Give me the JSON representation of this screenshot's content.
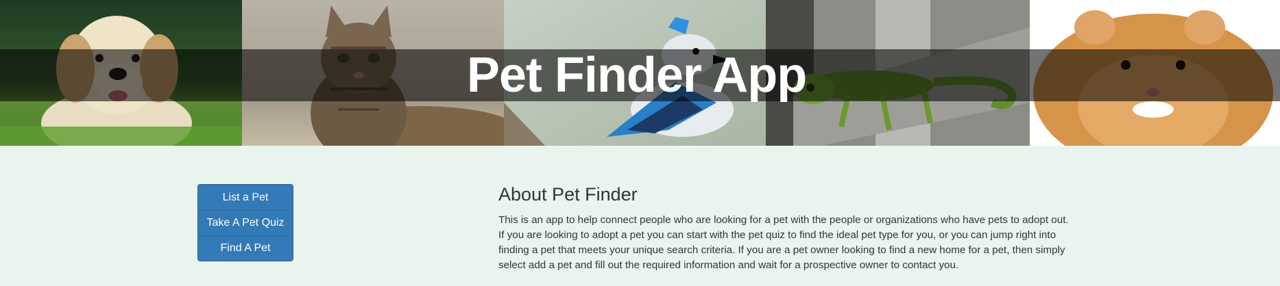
{
  "header": {
    "title": "Pet Finder App"
  },
  "banner": {
    "photos": [
      "dog-photo",
      "cat-photo",
      "blue-jay-photo",
      "chameleon-photo",
      "hamster-photo"
    ]
  },
  "nav": {
    "buttons": [
      {
        "label": "List a Pet"
      },
      {
        "label": "Take A Pet Quiz"
      },
      {
        "label": "Find A Pet"
      }
    ]
  },
  "about": {
    "heading": "About Pet Finder",
    "body": "This is an app to help connect people who are looking for a pet with the people or organizations who have pets to adopt out. If you are looking to adopt a pet you can start with the pet quiz to find the ideal pet type for you, or you can jump right into finding a pet that meets your unique search criteria. If you are a pet owner looking to find a new home for a pet, then simply select add a pet and fill out the required information and wait for a prospective owner to contact you."
  },
  "colors": {
    "page_background": "#eaf4ee",
    "button": "#337ab7",
    "title_strip": "rgba(0,0,0,0.55)"
  }
}
